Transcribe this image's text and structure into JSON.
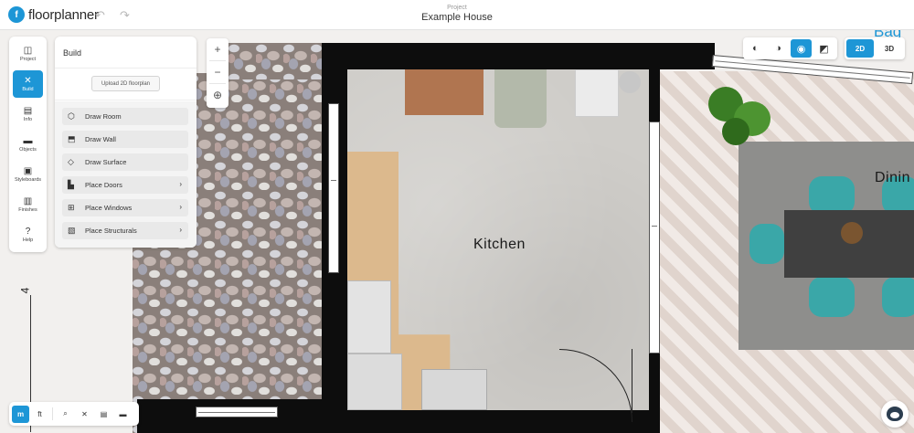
{
  "app": {
    "brand": "floorplanner",
    "logo_glyph": "f"
  },
  "header": {
    "caption": "Project",
    "title": "Example House",
    "undo_icon": "undo-icon",
    "redo_icon": "redo-icon"
  },
  "toolbar": {
    "items": [
      {
        "label": "Project",
        "glyph": "◫",
        "icon": "project-icon"
      },
      {
        "label": "Build",
        "glyph": "✕",
        "icon": "build-tools-icon",
        "active": true
      },
      {
        "label": "Info",
        "glyph": "▤",
        "icon": "info-icon"
      },
      {
        "label": "Objects",
        "glyph": "▬",
        "icon": "objects-icon"
      },
      {
        "label": "Styleboards",
        "glyph": "▣",
        "icon": "styleboards-icon"
      },
      {
        "label": "Finishes",
        "glyph": "▥",
        "icon": "finishes-icon"
      },
      {
        "label": "Help",
        "glyph": "?",
        "icon": "help-icon"
      }
    ]
  },
  "build_panel": {
    "title": "Build",
    "upload_label": "Upload 2D floorplan",
    "items": [
      {
        "label": "Draw Room",
        "glyph": "⬡",
        "icon": "draw-room-icon"
      },
      {
        "label": "Draw Wall",
        "glyph": "⬒",
        "icon": "draw-wall-icon"
      },
      {
        "label": "Draw Surface",
        "glyph": "◇",
        "icon": "draw-surface-icon"
      },
      {
        "label": "Place Doors",
        "glyph": "▙",
        "icon": "place-doors-icon",
        "chevron": "›"
      },
      {
        "label": "Place Windows",
        "glyph": "⊞",
        "icon": "place-windows-icon",
        "chevron": "›"
      },
      {
        "label": "Place Structurals",
        "glyph": "▧",
        "icon": "place-structurals-icon",
        "chevron": "›"
      }
    ]
  },
  "zoom": {
    "in": "+",
    "out": "−",
    "center": "⊕"
  },
  "view_modes": [
    {
      "glyph": "◐",
      "icon": "contrast-icon"
    },
    {
      "glyph": "◑",
      "icon": "shading-icon"
    },
    {
      "glyph": "◉",
      "icon": "color-icon",
      "active": true
    },
    {
      "glyph": "◩",
      "icon": "toggle-icon"
    }
  ],
  "dimension": {
    "two_d": "2D",
    "three_d": "3D",
    "active": "2D"
  },
  "bottom_toolbar": {
    "unit_m": "m",
    "unit_ft": "ft",
    "tools": [
      {
        "glyph": "⌕",
        "icon": "measure-search-icon"
      },
      {
        "glyph": "✕",
        "icon": "tools-icon"
      },
      {
        "glyph": "▤",
        "icon": "comment-icon"
      },
      {
        "glyph": "▬",
        "icon": "objects-icon"
      }
    ]
  },
  "canvas": {
    "room_kitchen": "Kitchen",
    "room_dining": "Dinin",
    "partial_label": "Bag",
    "ruler_value": "4"
  },
  "colors": {
    "accent": "#1d96d6",
    "wall": "#0d0d0d",
    "chair": "#3aa7a8"
  }
}
